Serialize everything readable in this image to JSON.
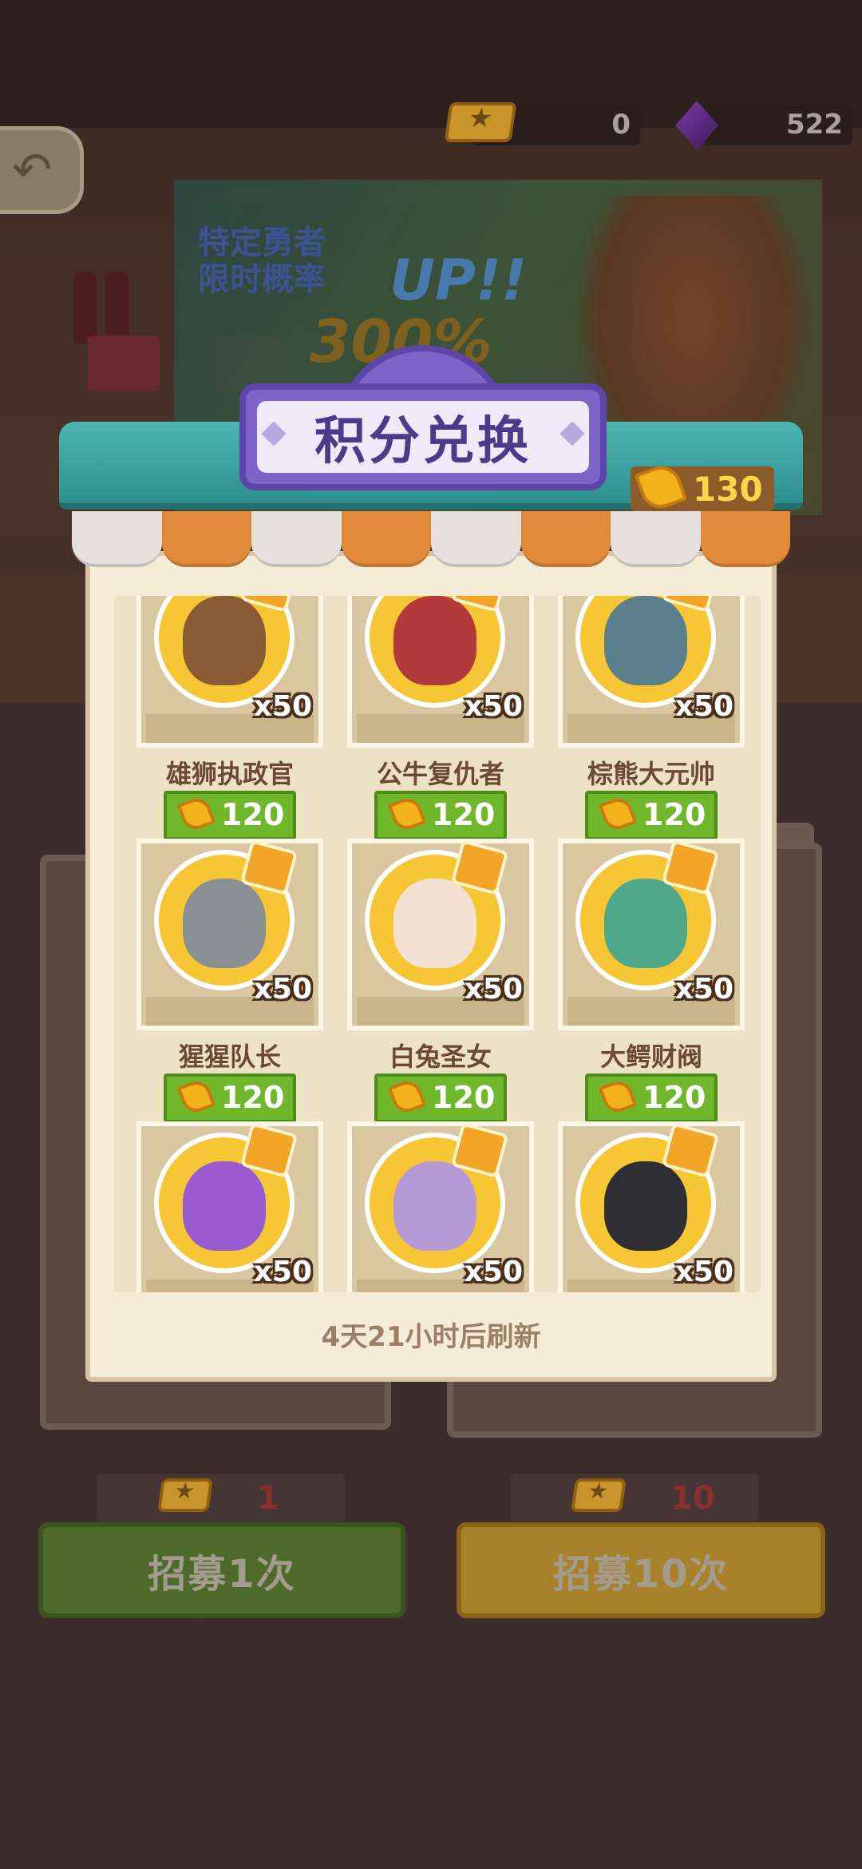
{
  "currencies": {
    "tickets": "0",
    "gems": "522"
  },
  "banner": {
    "tagline": "特定勇者\n限时概率",
    "up": "UP!!",
    "percent": "300%"
  },
  "shop": {
    "title": "积分兑换",
    "points": "130",
    "refresh_text": "4天21小时后刷新",
    "items": [
      {
        "name": "雄狮执政官",
        "qty": "x50",
        "price": "120",
        "color": "#8a5a34"
      },
      {
        "name": "公牛复仇者",
        "qty": "x50",
        "price": "120",
        "color": "#b23a3a"
      },
      {
        "name": "棕熊大元帅",
        "qty": "x50",
        "price": "120",
        "color": "#5c7f8e"
      },
      {
        "name": "猩猩队长",
        "qty": "x50",
        "price": "120",
        "color": "#8a8f96"
      },
      {
        "name": "白兔圣女",
        "qty": "x50",
        "price": "120",
        "color": "#f3e2d2"
      },
      {
        "name": "大鳄财阀",
        "qty": "x50",
        "price": "120",
        "color": "#4fa88a"
      },
      {
        "name": "",
        "qty": "x50",
        "price": "",
        "color": "#9a5ad0"
      },
      {
        "name": "",
        "qty": "x50",
        "price": "",
        "color": "#b59ad6"
      },
      {
        "name": "",
        "qty": "x50",
        "price": "",
        "color": "#2f2f33"
      }
    ]
  },
  "recruit": {
    "single": {
      "cost": "1",
      "label": "招募1次"
    },
    "ten": {
      "cost": "10",
      "label": "招募10次"
    }
  }
}
